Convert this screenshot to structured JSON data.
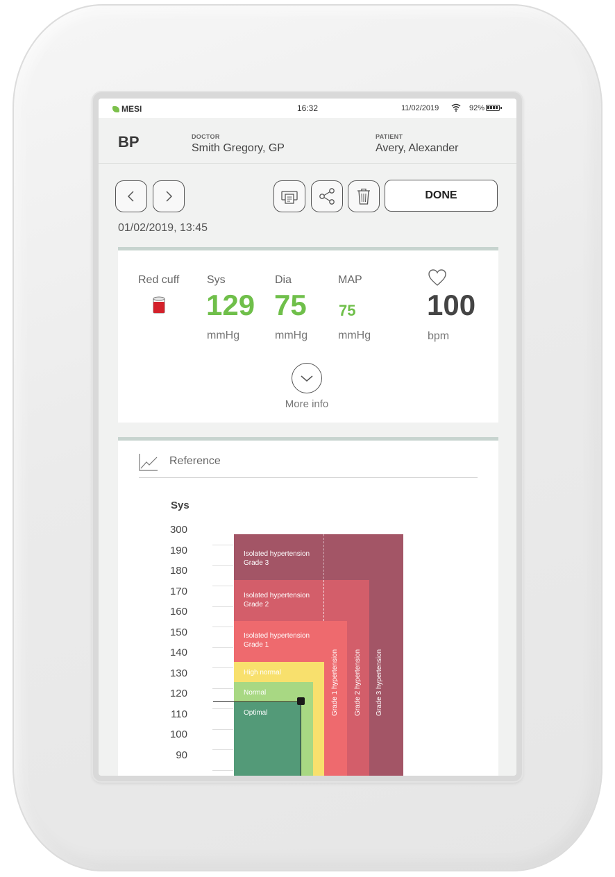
{
  "status_bar": {
    "brand": "MESI",
    "time": "16:32",
    "date": "11/02/2019",
    "battery_percent": "92%"
  },
  "header": {
    "mode": "BP",
    "doctor_label": "DOCTOR",
    "doctor_name": "Smith Gregory, GP",
    "patient_label": "PATIENT",
    "patient_name": "Avery, Alexander"
  },
  "toolbar": {
    "done_label": "DONE",
    "icons": [
      "chevron-left-icon",
      "chevron-right-icon",
      "print-icon",
      "share-icon",
      "trash-icon"
    ]
  },
  "measurement": {
    "timestamp": "01/02/2019, 13:45",
    "cuff_label": "Red cuff",
    "sys_label": "Sys",
    "sys_value": "129",
    "sys_unit": "mmHg",
    "dia_label": "Dia",
    "dia_value": "75",
    "dia_unit": "mmHg",
    "map_label": "MAP",
    "map_value": "75",
    "map_unit": "mmHg",
    "pulse_value": "100",
    "pulse_unit": "bpm",
    "more_info_label": "More info",
    "colors": {
      "good": "#6fbf4a",
      "cuff": "#d4202a"
    }
  },
  "reference": {
    "title": "Reference",
    "axis_title": "Sys",
    "y_ticks": [
      "300",
      "190",
      "180",
      "170",
      "160",
      "150",
      "140",
      "130",
      "120",
      "110",
      "100",
      "90"
    ],
    "zones": [
      {
        "label_line1": "Isolated hypertension",
        "label_line2": "Grade 3",
        "color": "#a35566"
      },
      {
        "label_line1": "Isolated hypertension",
        "label_line2": "Grade 2",
        "color": "#d35e6a"
      },
      {
        "label_line1": "Isolated hypertension",
        "label_line2": "Grade 1",
        "color": "#ee6a6e"
      },
      {
        "label_line1": "High normal",
        "label_line2": "",
        "color": "#f8e06d"
      },
      {
        "label_line1": "Normal",
        "label_line2": "",
        "color": "#a8d883"
      },
      {
        "label_line1": "Optimal",
        "label_line2": "",
        "color": "#539a78"
      }
    ],
    "vertical_labels": [
      "Grade 1 hypertension",
      "Grade 2 hypertension",
      "Grade 3 hypertension"
    ],
    "marker": {
      "sys": 129,
      "dia": 75
    }
  }
}
